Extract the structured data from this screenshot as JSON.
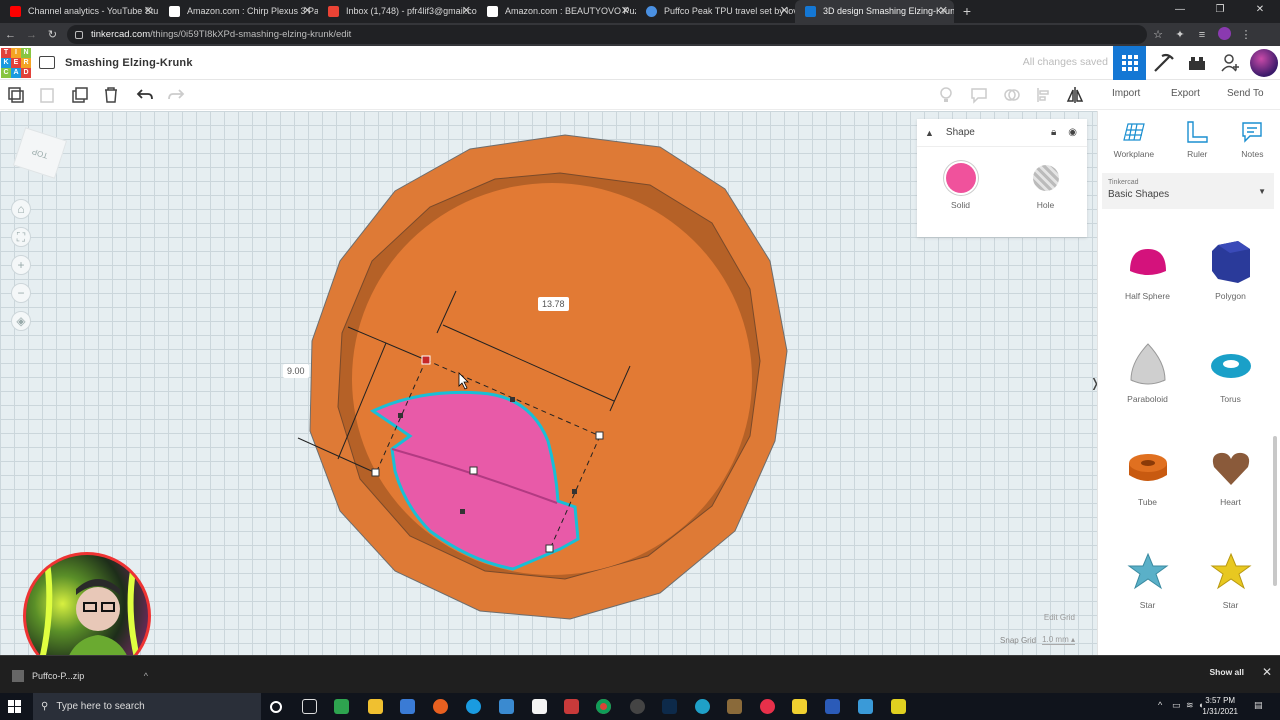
{
  "browser": {
    "tabs": [
      {
        "title": "Channel analytics - YouTube Stu",
        "color": "#ff0000"
      },
      {
        "title": "Amazon.com : Chirp Plexus 3 Pa",
        "color": "#ffffff"
      },
      {
        "title": "Inbox (1,748) - pfr4lif3@gmail.co",
        "color": "#ea4335"
      },
      {
        "title": "Amazon.com : BEAUTYOVO Puz",
        "color": "#ffffff"
      },
      {
        "title": "Puffco Peak TPU travel set by lov",
        "color": "#4a90e2"
      },
      {
        "title": "3D design Smashing Elzing-Krun",
        "color": "#1477d4"
      }
    ],
    "url_host": "tinkercad.com",
    "url_path": "/things/0i59TI8kXPd-smashing-elzing-krunk/edit"
  },
  "header": {
    "logo_letters": [
      "T",
      "I",
      "N",
      "K",
      "E",
      "R",
      "C",
      "A",
      "D"
    ],
    "project_title": "Smashing Elzing-Krunk",
    "save_status": "All changes saved"
  },
  "toolbar": {
    "import_label": "Import",
    "export_label": "Export",
    "sendto_label": "Send To"
  },
  "viewport": {
    "viewcube_label": "TOP",
    "dimension_length": "13.78",
    "dimension_width": "9.00",
    "edit_grid_label": "Edit Grid",
    "snap_grid_label": "Snap Grid",
    "snap_grid_value": "1.0 mm ▴"
  },
  "inspector": {
    "title": "Shape",
    "solid_label": "Solid",
    "hole_label": "Hole"
  },
  "right_panel": {
    "tools": [
      {
        "label": "Workplane"
      },
      {
        "label": "Ruler"
      },
      {
        "label": "Notes"
      }
    ],
    "library_source": "Tinkercad",
    "library_name": "Basic Shapes",
    "shapes": [
      {
        "label": "Half Sphere",
        "color": "#d4127c"
      },
      {
        "label": "Polygon",
        "color": "#2a3a9a"
      },
      {
        "label": "Paraboloid",
        "color": "#c8c8c8"
      },
      {
        "label": "Torus",
        "color": "#1aa0c8"
      },
      {
        "label": "Tube",
        "color": "#e07020"
      },
      {
        "label": "Heart",
        "color": "#8a5a3a"
      },
      {
        "label": "Star",
        "color": "#5ab0c8"
      },
      {
        "label": "Star",
        "color": "#e8c820"
      }
    ]
  },
  "download_bar": {
    "item_label": "Puffco-P...zip",
    "show_all_label": "Show all"
  },
  "taskbar": {
    "search_placeholder": "Type here to search",
    "time": "3:57 PM",
    "date": "1/31/2021"
  }
}
